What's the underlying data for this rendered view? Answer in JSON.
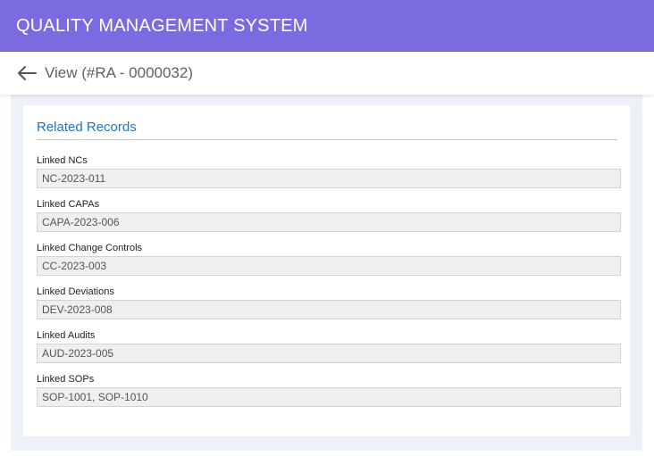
{
  "app": {
    "title": "QUALITY MANAGEMENT SYSTEM",
    "brand_color": "#7b6be0"
  },
  "subheader": {
    "back_icon": "arrow-left-icon",
    "title": "View (#RA - 0000032)"
  },
  "section": {
    "title": "Related Records",
    "title_color": "#1c78c0"
  },
  "fields": [
    {
      "label": "Linked NCs",
      "value": "NC-2023-011"
    },
    {
      "label": "Linked CAPAs",
      "value": "CAPA-2023-006"
    },
    {
      "label": "Linked Change Controls",
      "value": "CC-2023-003"
    },
    {
      "label": "Linked Deviations",
      "value": "DEV-2023-008"
    },
    {
      "label": "Linked Audits",
      "value": "AUD-2023-005"
    },
    {
      "label": "Linked SOPs",
      "value": "SOP-1001, SOP-1010"
    }
  ]
}
